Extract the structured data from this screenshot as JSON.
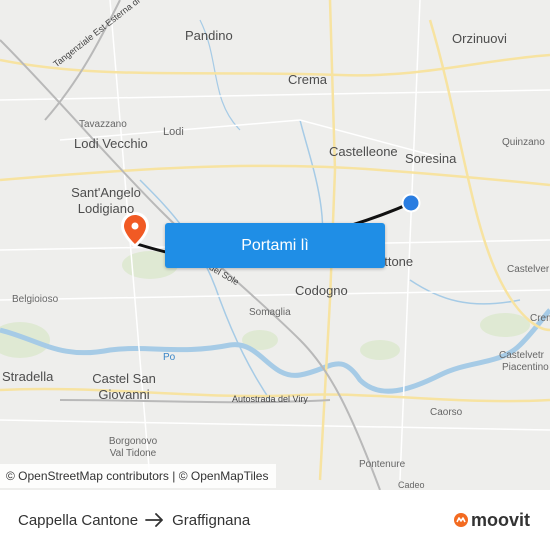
{
  "map": {
    "towns": {
      "pandino": "Pandino",
      "orzinuovi": "Orzinuovi",
      "crema": "Crema",
      "lodi": "Lodi",
      "lodi_vecchio": "Lodi Vecchio",
      "castelleone": "Castelleone",
      "soresina": "Soresina",
      "santangelo": "Sant'Angelo",
      "lodigiano": "Lodigiano",
      "pizzighettone": "ettone",
      "codogno": "Codogno",
      "stradella": "Stradella",
      "castel_san": "Castel San",
      "giovanni": "Giovanni",
      "cremona_partial": "Crem"
    },
    "small_places": {
      "tavazzano": "Tavazzano",
      "quinzano": "Quinzano",
      "castelverde": "Castelver",
      "belgioioso": "Belgioioso",
      "somaglia": "Somaglia",
      "castelvetro_1": "Castelvetr",
      "castelvetro_2": "Piacentino",
      "caorso": "Caorso",
      "borgonovo_1": "Borgonovo",
      "borgonovo_2": "Val Tidone",
      "pontenure": "Pontenure",
      "cadeo": "Cadeo"
    },
    "rivers": {
      "po": "Po"
    },
    "roads": {
      "tangenziale": "Tangenziale Est Esterna di Milano",
      "autostrada_viry": "Autostrada del Viry",
      "autostrada_sole": "del Sole"
    },
    "attribution": "© OpenStreetMap contributors | © OpenMapTiles",
    "colors": {
      "route": "#111111",
      "start_marker": "#2a7de1",
      "end_marker": "#f15a24",
      "cta": "#1f8ee6"
    }
  },
  "cta": {
    "label": "Portami lì"
  },
  "footer": {
    "origin": "Cappella Cantone",
    "destination": "Graffignana",
    "brand": "moovit",
    "brand_color": "#f36b21"
  }
}
